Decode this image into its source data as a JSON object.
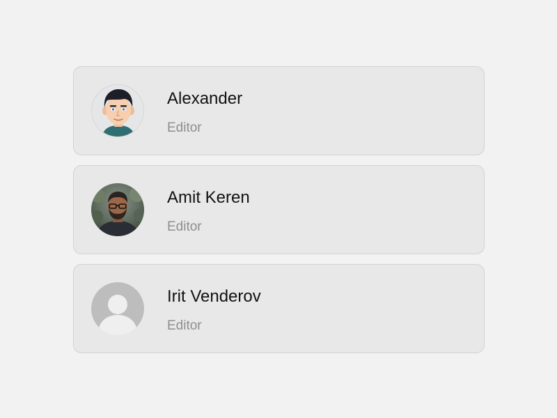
{
  "users": [
    {
      "name": "Alexander",
      "role": "Editor",
      "avatar": "cartoon-man-avatar"
    },
    {
      "name": "Amit Keren",
      "role": "Editor",
      "avatar": "photo-man-with-glasses-avatar"
    },
    {
      "name": "Irit Venderov",
      "role": "Editor",
      "avatar": "default-person-placeholder-icon"
    }
  ],
  "colors": {
    "background": "#f2f2f2",
    "card": "#e8e8e8",
    "card_border": "#d2d2d2",
    "name_text": "#111111",
    "role_text": "#8e8e8e"
  }
}
